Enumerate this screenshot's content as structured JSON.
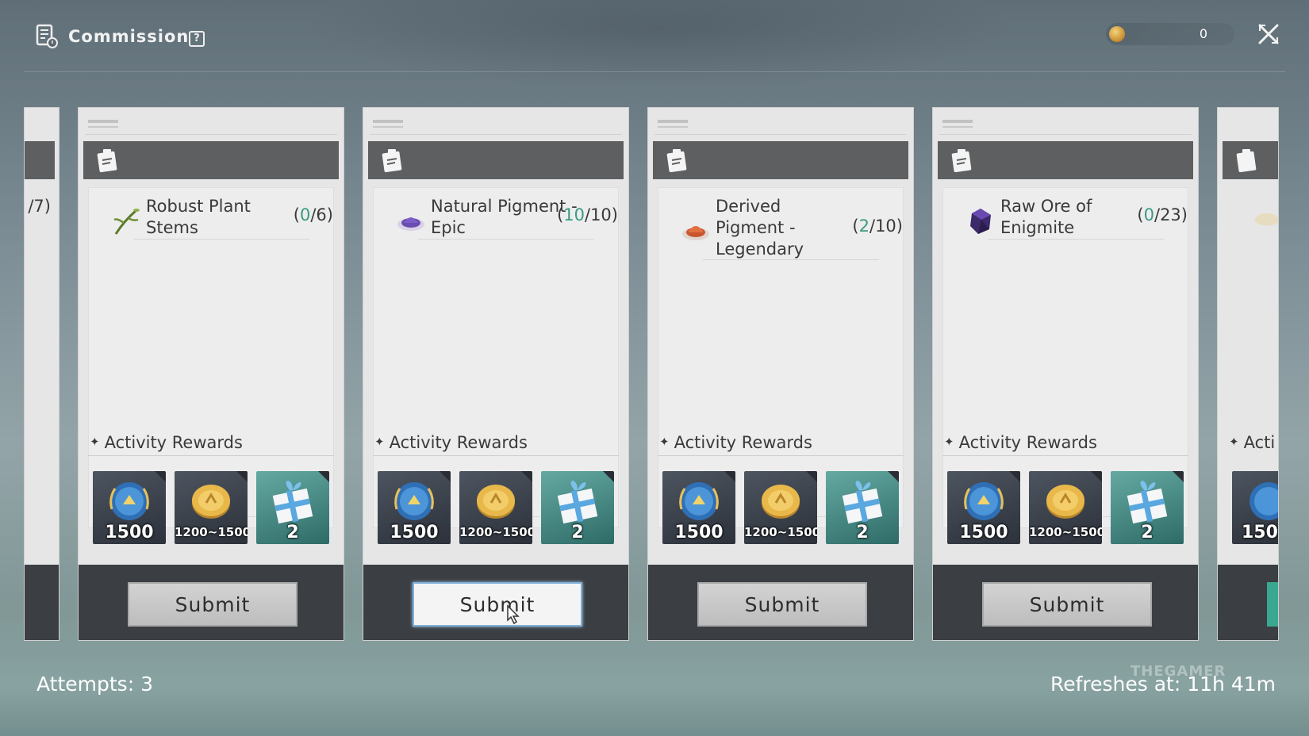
{
  "header": {
    "title": "Commission",
    "help_label": "?",
    "currency_value": "0"
  },
  "left_partial": {
    "count_fragment": "/7)"
  },
  "cards": [
    {
      "item_name": "Robust Plant Stems",
      "count_open": "(",
      "current": "0",
      "total": "/6)",
      "rewards_title": "Activity Rewards",
      "rewards": [
        {
          "icon": "medal-icon",
          "qty": "1500"
        },
        {
          "icon": "gold-coin-icon",
          "qty": "1200~1500"
        },
        {
          "icon": "gift-box-icon",
          "qty": "2"
        }
      ],
      "submit_label": "Submit"
    },
    {
      "item_name": "Natural Pigment - Epic",
      "count_open": "(",
      "current": "10",
      "total": "/10)",
      "rewards_title": "Activity Rewards",
      "rewards": [
        {
          "icon": "medal-icon",
          "qty": "1500"
        },
        {
          "icon": "gold-coin-icon",
          "qty": "1200~1500"
        },
        {
          "icon": "gift-box-icon",
          "qty": "2"
        }
      ],
      "submit_label": "Submit"
    },
    {
      "item_name": "Derived Pigment - Legendary",
      "count_open": "(",
      "current": "2",
      "total": "/10)",
      "rewards_title": "Activity Rewards",
      "rewards": [
        {
          "icon": "medal-icon",
          "qty": "1500"
        },
        {
          "icon": "gold-coin-icon",
          "qty": "1200~1500"
        },
        {
          "icon": "gift-box-icon",
          "qty": "2"
        }
      ],
      "submit_label": "Submit"
    },
    {
      "item_name": "Raw Ore of Enigmite",
      "count_open": "(",
      "current": "0",
      "total": "/23)",
      "rewards_title": "Activity Rewards",
      "rewards": [
        {
          "icon": "medal-icon",
          "qty": "1500"
        },
        {
          "icon": "gold-coin-icon",
          "qty": "1200~1500"
        },
        {
          "icon": "gift-box-icon",
          "qty": "2"
        }
      ],
      "submit_label": "Submit"
    }
  ],
  "right_partial": {
    "rewards_fragment": "Acti",
    "qty_fragment": "150"
  },
  "footer": {
    "attempts": "Attempts: 3",
    "refresh": "Refreshes at: 11h 41m"
  },
  "watermark": "THEGAMER"
}
